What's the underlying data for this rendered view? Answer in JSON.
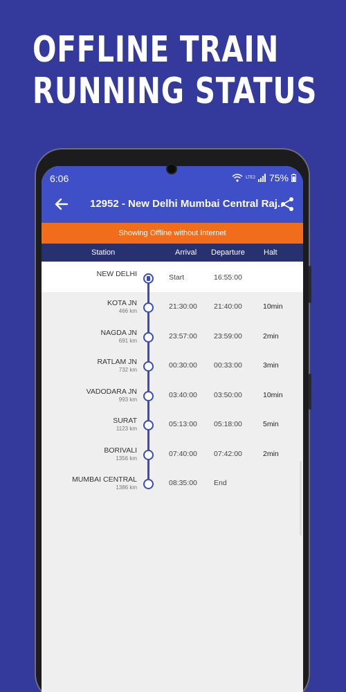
{
  "headline": {
    "line1": "OFFLINE TRAIN",
    "line2": "RUNNING STATUS"
  },
  "status_bar": {
    "time": "6:06",
    "battery": "75%",
    "network": "LTE2"
  },
  "app_bar": {
    "title": "12952 - New Delhi Mumbai Central Raj.."
  },
  "banner": {
    "text": "Showing Offline without Internet"
  },
  "columns": {
    "station": "Station",
    "arrival": "Arrival",
    "departure": "Departure",
    "halt": "Halt"
  },
  "stations": [
    {
      "name": "NEW DELHI",
      "km": "",
      "arrival": "Start",
      "departure": "16:55:00",
      "halt": ""
    },
    {
      "name": "KOTA JN",
      "km": "466 km",
      "arrival": "21:30:00",
      "departure": "21:40:00",
      "halt": "10min"
    },
    {
      "name": "NAGDA JN",
      "km": "691 km",
      "arrival": "23:57:00",
      "departure": "23:59:00",
      "halt": "2min"
    },
    {
      "name": "RATLAM JN",
      "km": "732 km",
      "arrival": "00:30:00",
      "departure": "00:33:00",
      "halt": "3min"
    },
    {
      "name": "VADODARA JN",
      "km": "993 km",
      "arrival": "03:40:00",
      "departure": "03:50:00",
      "halt": "10min"
    },
    {
      "name": "SURAT",
      "km": "1123 km",
      "arrival": "05:13:00",
      "departure": "05:18:00",
      "halt": "5min"
    },
    {
      "name": "BORIVALI",
      "km": "1356 km",
      "arrival": "07:40:00",
      "departure": "07:42:00",
      "halt": "2min"
    },
    {
      "name": "MUMBAI CENTRAL",
      "km": "1386 km",
      "arrival": "08:35:00",
      "departure": "End",
      "halt": ""
    }
  ],
  "icons": {
    "back": "arrow-left-icon",
    "share": "share-icon",
    "wifi": "wifi-icon",
    "signal": "signal-icon",
    "battery": "battery-icon"
  },
  "colors": {
    "background": "#333a9c",
    "app_bar": "#3f4fc7",
    "banner": "#f26d1b",
    "header": "#28316f",
    "track": "#3a4ab8"
  }
}
